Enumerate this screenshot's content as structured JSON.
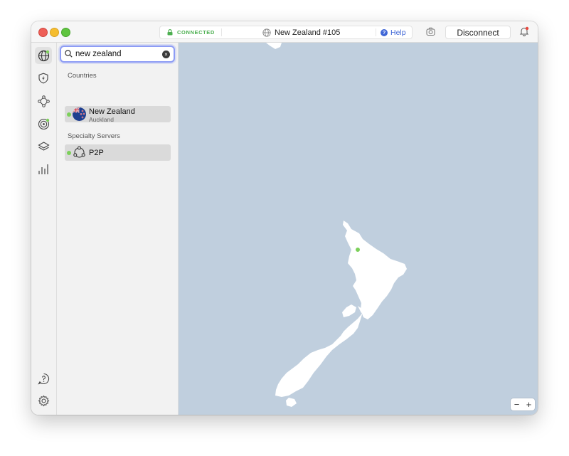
{
  "titlebar": {
    "status": "CONNECTED",
    "server": "New Zealand #105",
    "help_label": "Help",
    "disconnect_label": "Disconnect"
  },
  "search": {
    "value": "new zealand"
  },
  "sections": {
    "countries": "Countries",
    "specialty": "Specialty Servers"
  },
  "countries": [
    {
      "name": "New Zealand",
      "city": "Auckland"
    }
  ],
  "specialty": [
    {
      "name": "P2P"
    }
  ],
  "map": {
    "zoom_out": "−",
    "zoom_in": "+"
  },
  "colors": {
    "accent": "#3f66d6",
    "connected": "#4caf50",
    "map_water": "#c0cfde",
    "land": "#ffffff",
    "server_dot": "#7cd05a"
  },
  "icons": {
    "rail": [
      "globe-icon",
      "shield-bolt-icon",
      "meshnet-icon",
      "radar-icon",
      "layers-icon",
      "stats-icon",
      "help-chat-icon",
      "settings-icon"
    ]
  }
}
